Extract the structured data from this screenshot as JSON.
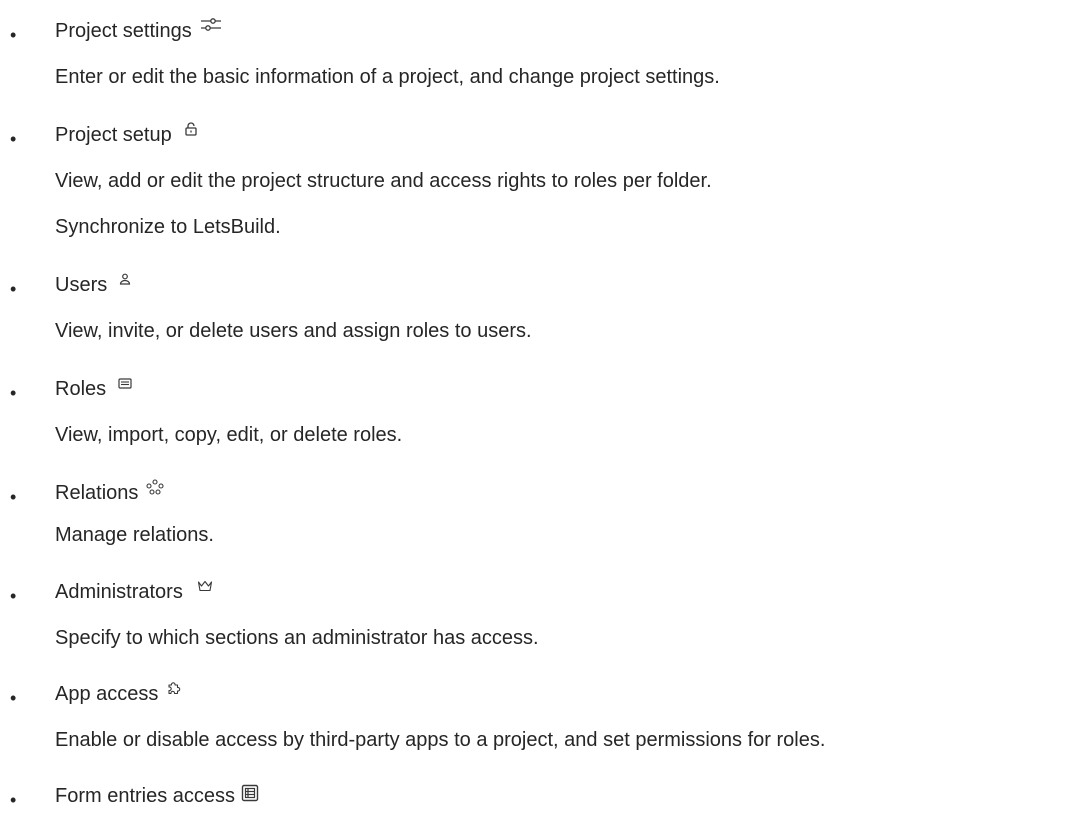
{
  "items": [
    {
      "title": "Project settings",
      "icon": "sliders-icon",
      "lines": [
        "Enter or edit the basic information of a project, and change project settings."
      ]
    },
    {
      "title": "Project setup",
      "icon": "unlock-icon",
      "lines": [
        "View, add or edit the project structure and access rights to roles per folder.",
        "Synchronize to LetsBuild."
      ]
    },
    {
      "title": "Users",
      "icon": "user-icon",
      "lines": [
        "View, invite, or delete users and assign roles to users."
      ]
    },
    {
      "title": "Roles",
      "icon": "id-card-icon",
      "lines": [
        "View, import, copy, edit, or delete roles."
      ]
    },
    {
      "title": "Relations",
      "icon": "relations-icon",
      "lines": [
        "Manage relations."
      ]
    },
    {
      "title": "Administrators",
      "icon": "crown-icon",
      "lines": [
        "Specify to which sections an administrator has access."
      ]
    },
    {
      "title": "App access",
      "icon": "puzzle-icon",
      "lines": [
        "Enable or disable access by third-party apps to a project, and set permissions for roles."
      ]
    },
    {
      "title": "Form entries access",
      "icon": "form-icon",
      "lines": []
    }
  ],
  "bullet_char": "•"
}
